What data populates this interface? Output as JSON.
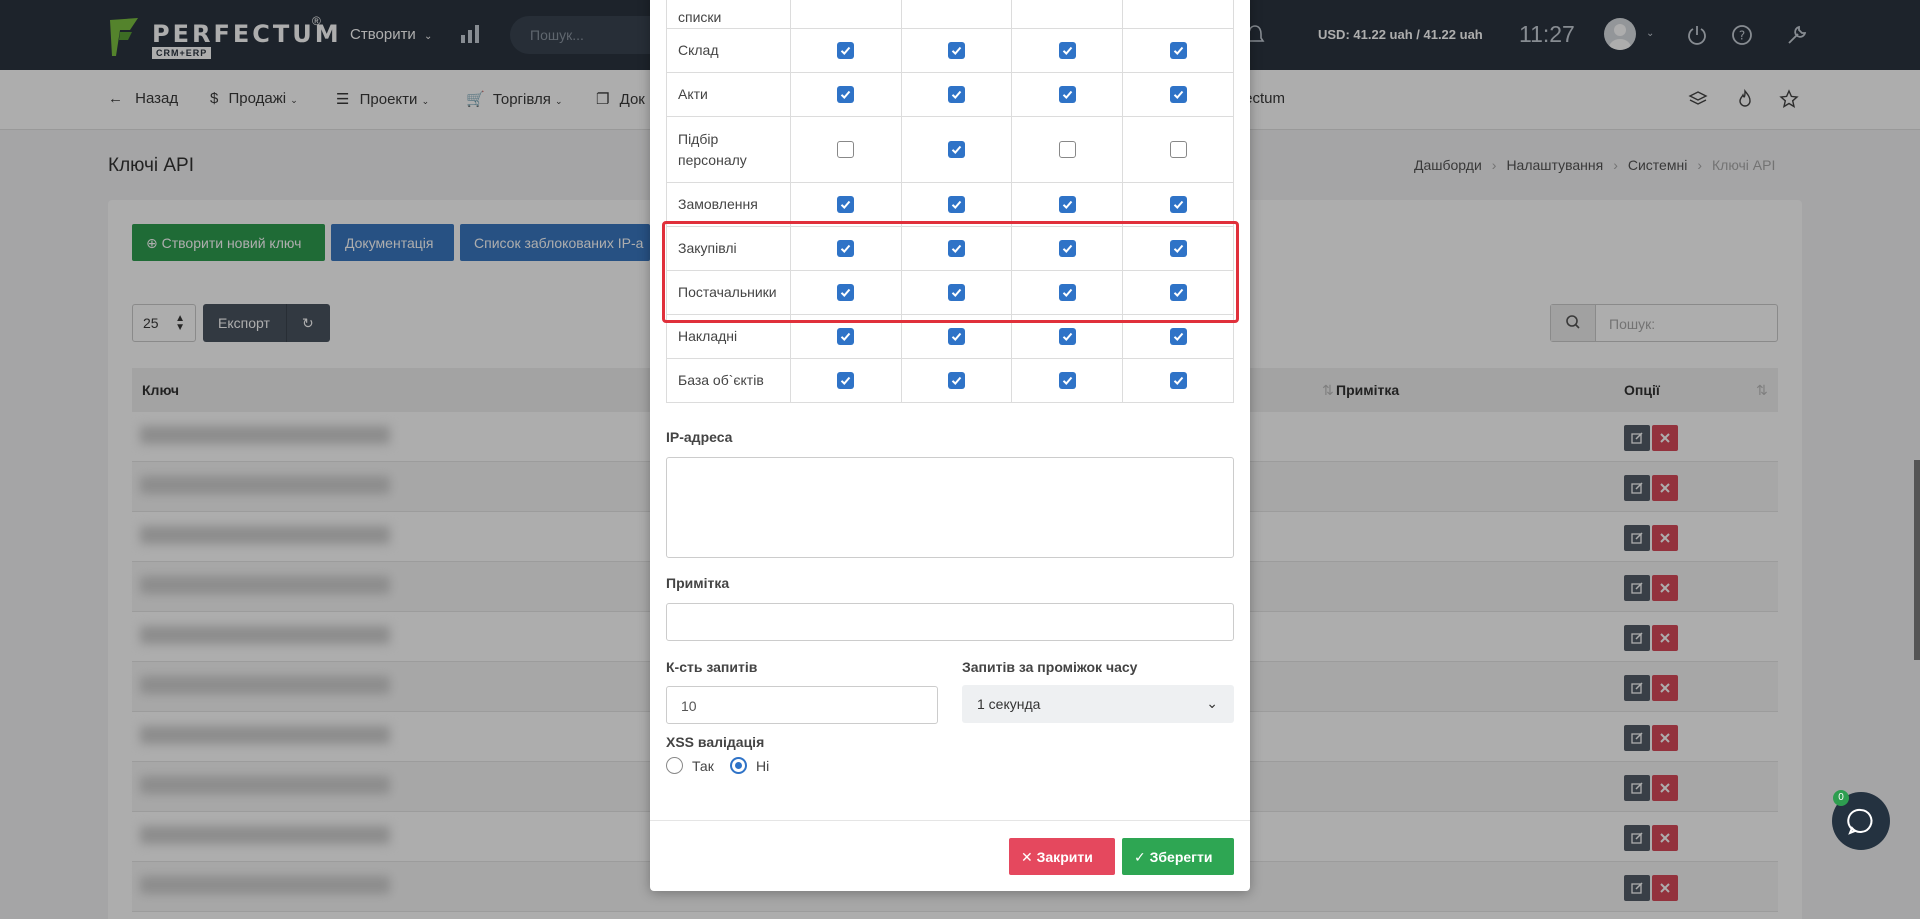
{
  "header": {
    "logo_text": "PERFECTUM",
    "logo_reg": "®",
    "logo_sub": "CRM+ERP",
    "create_menu": "Створити",
    "search_placeholder": "Пошук...",
    "currency": "USD: 41.22 uah / 41.22 uah",
    "time": "11:27"
  },
  "nav": {
    "items": [
      "Назад",
      "Продажі",
      "Проекти",
      "Торгівля",
      "Док",
      "fectum"
    ]
  },
  "page": {
    "title": "Ключі API",
    "breadcrumb": [
      "Дашборди",
      "Налаштування",
      "Системні",
      "Ключі API"
    ]
  },
  "toolbar": {
    "create_key": "Створити новий ключ",
    "docs": "Документація",
    "blocked_ips": "Список заблокованих IP-а",
    "page_length": "25",
    "export": "Експорт",
    "search_placeholder": "Пошук:"
  },
  "table": {
    "columns": {
      "key": "Ключ",
      "note": "Примітка",
      "options": "Опції"
    },
    "row_count": 10
  },
  "modal": {
    "permissions": [
      {
        "label": "списки",
        "values": [
          null,
          null,
          null,
          null
        ]
      },
      {
        "label": "Склад",
        "values": [
          true,
          true,
          true,
          true
        ]
      },
      {
        "label": "Акти",
        "values": [
          true,
          true,
          true,
          true
        ]
      },
      {
        "label": "Підбір персоналу",
        "values": [
          false,
          true,
          false,
          false
        ]
      },
      {
        "label": "Замовлення",
        "values": [
          true,
          true,
          true,
          true
        ]
      },
      {
        "label": "Закупівлі",
        "values": [
          true,
          true,
          true,
          true
        ]
      },
      {
        "label": "Постачальники",
        "values": [
          true,
          true,
          true,
          true
        ]
      },
      {
        "label": "Накладні",
        "values": [
          true,
          true,
          true,
          true
        ]
      },
      {
        "label": "База об`єктів",
        "values": [
          true,
          true,
          true,
          true
        ]
      }
    ],
    "ip_label": "IP-адреса",
    "note_label": "Примітка",
    "requests_label": "К-сть запитів",
    "requests_value": "10",
    "interval_label": "Запитів за проміжок часу",
    "interval_value": "1 секунда",
    "xss_label": "XSS валідація",
    "xss_yes": "Так",
    "xss_no": "Ні",
    "xss_selected": "Ні",
    "close_btn": "Закрити",
    "save_btn": "Зберегти"
  },
  "chat": {
    "badge": "0"
  },
  "colors": {
    "accent_blue": "#2f73c7",
    "green": "#2e9e50",
    "red": "#e5485e",
    "highlight": "#e0303b"
  }
}
